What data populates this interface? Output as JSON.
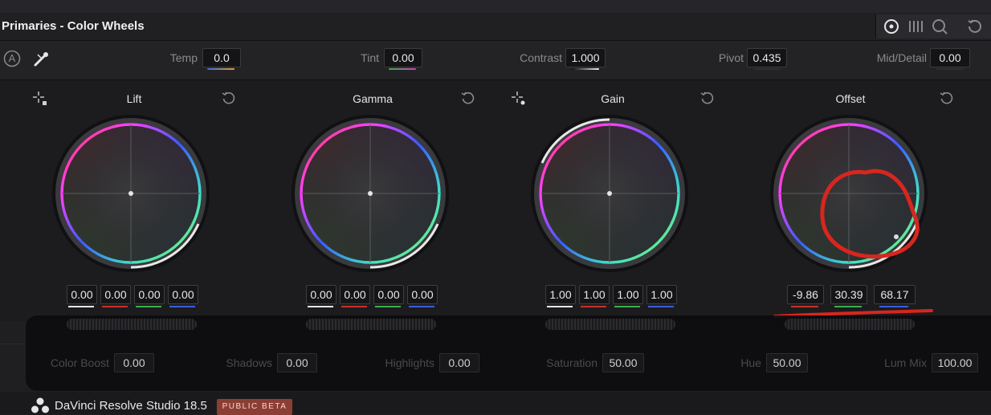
{
  "panel": {
    "title": "Primaries - Color Wheels"
  },
  "toolbar": {
    "icons": [
      "color-wheels-icon",
      "bars-icon",
      "log-wheels-icon",
      "reset-all-icon"
    ],
    "auto_label": "A",
    "picker_icon": "eyedropper-icon"
  },
  "adjust": {
    "temp": {
      "label": "Temp",
      "value": "0.0"
    },
    "tint": {
      "label": "Tint",
      "value": "0.00"
    },
    "contrast": {
      "label": "Contrast",
      "value": "1.000"
    },
    "pivot": {
      "label": "Pivot",
      "value": "0.435"
    },
    "mid_detail": {
      "label": "Mid/Detail",
      "value": "0.00"
    }
  },
  "wheels": {
    "lift": {
      "label": "Lift",
      "values": [
        "0.00",
        "0.00",
        "0.00",
        "0.00"
      ]
    },
    "gamma": {
      "label": "Gamma",
      "values": [
        "0.00",
        "0.00",
        "0.00",
        "0.00"
      ]
    },
    "gain": {
      "label": "Gain",
      "values": [
        "1.00",
        "1.00",
        "1.00",
        "1.00"
      ]
    },
    "offset": {
      "label": "Offset",
      "values": [
        "-9.86",
        "30.39",
        "68.17"
      ]
    }
  },
  "bottom": {
    "color_boost": {
      "label": "Color Boost",
      "value": "0.00"
    },
    "shadows": {
      "label": "Shadows",
      "value": "0.00"
    },
    "highlights": {
      "label": "Highlights",
      "value": "0.00"
    },
    "saturation": {
      "label": "Saturation",
      "value": "50.00"
    },
    "hue": {
      "label": "Hue",
      "value": "50.00"
    },
    "lum_mix": {
      "label": "Lum Mix",
      "value": "100.00"
    }
  },
  "footer": {
    "app_name": "DaVinci Resolve Studio 18.5",
    "badge": "PUBLIC BETA"
  },
  "colors": {
    "accent_red": "#d8261e",
    "channel_white": "#e6e6e6",
    "channel_red": "#c8322c",
    "channel_green": "#3fae4a",
    "channel_blue": "#3a5ee0",
    "badge_bg": "#8c3e34"
  }
}
